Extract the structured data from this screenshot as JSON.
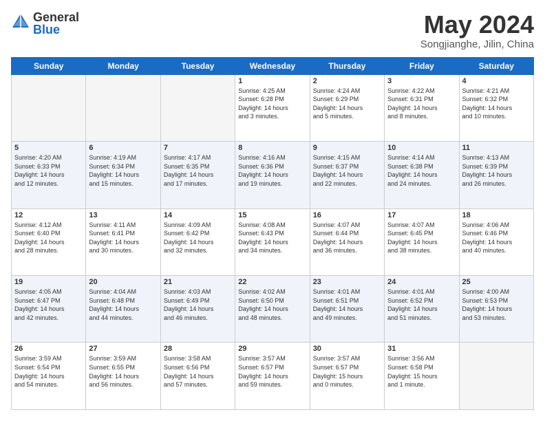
{
  "header": {
    "logo_general": "General",
    "logo_blue": "Blue",
    "month_title": "May 2024",
    "location": "Songjianghe, Jilin, China"
  },
  "weekdays": [
    "Sunday",
    "Monday",
    "Tuesday",
    "Wednesday",
    "Thursday",
    "Friday",
    "Saturday"
  ],
  "weeks": [
    [
      {
        "day": "",
        "info": ""
      },
      {
        "day": "",
        "info": ""
      },
      {
        "day": "",
        "info": ""
      },
      {
        "day": "1",
        "info": "Sunrise: 4:25 AM\nSunset: 6:28 PM\nDaylight: 14 hours\nand 3 minutes."
      },
      {
        "day": "2",
        "info": "Sunrise: 4:24 AM\nSunset: 6:29 PM\nDaylight: 14 hours\nand 5 minutes."
      },
      {
        "day": "3",
        "info": "Sunrise: 4:22 AM\nSunset: 6:31 PM\nDaylight: 14 hours\nand 8 minutes."
      },
      {
        "day": "4",
        "info": "Sunrise: 4:21 AM\nSunset: 6:32 PM\nDaylight: 14 hours\nand 10 minutes."
      }
    ],
    [
      {
        "day": "5",
        "info": "Sunrise: 4:20 AM\nSunset: 6:33 PM\nDaylight: 14 hours\nand 12 minutes."
      },
      {
        "day": "6",
        "info": "Sunrise: 4:19 AM\nSunset: 6:34 PM\nDaylight: 14 hours\nand 15 minutes."
      },
      {
        "day": "7",
        "info": "Sunrise: 4:17 AM\nSunset: 6:35 PM\nDaylight: 14 hours\nand 17 minutes."
      },
      {
        "day": "8",
        "info": "Sunrise: 4:16 AM\nSunset: 6:36 PM\nDaylight: 14 hours\nand 19 minutes."
      },
      {
        "day": "9",
        "info": "Sunrise: 4:15 AM\nSunset: 6:37 PM\nDaylight: 14 hours\nand 22 minutes."
      },
      {
        "day": "10",
        "info": "Sunrise: 4:14 AM\nSunset: 6:38 PM\nDaylight: 14 hours\nand 24 minutes."
      },
      {
        "day": "11",
        "info": "Sunrise: 4:13 AM\nSunset: 6:39 PM\nDaylight: 14 hours\nand 26 minutes."
      }
    ],
    [
      {
        "day": "12",
        "info": "Sunrise: 4:12 AM\nSunset: 6:40 PM\nDaylight: 14 hours\nand 28 minutes."
      },
      {
        "day": "13",
        "info": "Sunrise: 4:11 AM\nSunset: 6:41 PM\nDaylight: 14 hours\nand 30 minutes."
      },
      {
        "day": "14",
        "info": "Sunrise: 4:09 AM\nSunset: 6:42 PM\nDaylight: 14 hours\nand 32 minutes."
      },
      {
        "day": "15",
        "info": "Sunrise: 4:08 AM\nSunset: 6:43 PM\nDaylight: 14 hours\nand 34 minutes."
      },
      {
        "day": "16",
        "info": "Sunrise: 4:07 AM\nSunset: 6:44 PM\nDaylight: 14 hours\nand 36 minutes."
      },
      {
        "day": "17",
        "info": "Sunrise: 4:07 AM\nSunset: 6:45 PM\nDaylight: 14 hours\nand 38 minutes."
      },
      {
        "day": "18",
        "info": "Sunrise: 4:06 AM\nSunset: 6:46 PM\nDaylight: 14 hours\nand 40 minutes."
      }
    ],
    [
      {
        "day": "19",
        "info": "Sunrise: 4:05 AM\nSunset: 6:47 PM\nDaylight: 14 hours\nand 42 minutes."
      },
      {
        "day": "20",
        "info": "Sunrise: 4:04 AM\nSunset: 6:48 PM\nDaylight: 14 hours\nand 44 minutes."
      },
      {
        "day": "21",
        "info": "Sunrise: 4:03 AM\nSunset: 6:49 PM\nDaylight: 14 hours\nand 46 minutes."
      },
      {
        "day": "22",
        "info": "Sunrise: 4:02 AM\nSunset: 6:50 PM\nDaylight: 14 hours\nand 48 minutes."
      },
      {
        "day": "23",
        "info": "Sunrise: 4:01 AM\nSunset: 6:51 PM\nDaylight: 14 hours\nand 49 minutes."
      },
      {
        "day": "24",
        "info": "Sunrise: 4:01 AM\nSunset: 6:52 PM\nDaylight: 14 hours\nand 51 minutes."
      },
      {
        "day": "25",
        "info": "Sunrise: 4:00 AM\nSunset: 6:53 PM\nDaylight: 14 hours\nand 53 minutes."
      }
    ],
    [
      {
        "day": "26",
        "info": "Sunrise: 3:59 AM\nSunset: 6:54 PM\nDaylight: 14 hours\nand 54 minutes."
      },
      {
        "day": "27",
        "info": "Sunrise: 3:59 AM\nSunset: 6:55 PM\nDaylight: 14 hours\nand 56 minutes."
      },
      {
        "day": "28",
        "info": "Sunrise: 3:58 AM\nSunset: 6:56 PM\nDaylight: 14 hours\nand 57 minutes."
      },
      {
        "day": "29",
        "info": "Sunrise: 3:57 AM\nSunset: 6:57 PM\nDaylight: 14 hours\nand 59 minutes."
      },
      {
        "day": "30",
        "info": "Sunrise: 3:57 AM\nSunset: 6:57 PM\nDaylight: 15 hours\nand 0 minutes."
      },
      {
        "day": "31",
        "info": "Sunrise: 3:56 AM\nSunset: 6:58 PM\nDaylight: 15 hours\nand 1 minute."
      },
      {
        "day": "",
        "info": ""
      }
    ]
  ]
}
